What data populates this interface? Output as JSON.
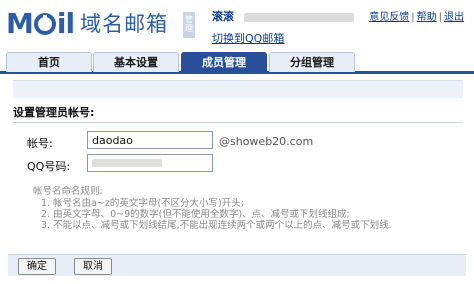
{
  "header": {
    "logo_text_m": "M",
    "logo_text_rest": "il",
    "logo_title": "域名邮箱",
    "logo_badge": "管理",
    "user_name": "滚滚",
    "switch_link": "切换到QQ邮箱",
    "top_links": [
      "意见反馈",
      "帮助",
      "退出"
    ]
  },
  "tabs": [
    {
      "label": "首页",
      "active": false
    },
    {
      "label": "基本设置",
      "active": false
    },
    {
      "label": "成员管理",
      "active": true
    },
    {
      "label": "分组管理",
      "active": false
    }
  ],
  "form": {
    "section_title": "设置管理员帐号:",
    "account_label": "帐号:",
    "account_value": "daodao",
    "account_suffix": "@showeb20.com",
    "qq_label": "QQ号码:"
  },
  "rules": {
    "heading": "帐号名命名规则:",
    "items": [
      "1. 帐号名由a~z的英文字母(不区分大小写)开头;",
      "2. 由英文字母、0~9的数字(但不能使用全数字)、点、减号或下划线组成;",
      "3. 不能以点、减号或下划线结尾,不能出现连续两个或两个以上的点、减号或下划线."
    ]
  },
  "buttons": {
    "ok": "确定",
    "cancel": "取消"
  },
  "colors": {
    "brand": "#2c5ea8",
    "tab_active": "#2a4f9a"
  }
}
